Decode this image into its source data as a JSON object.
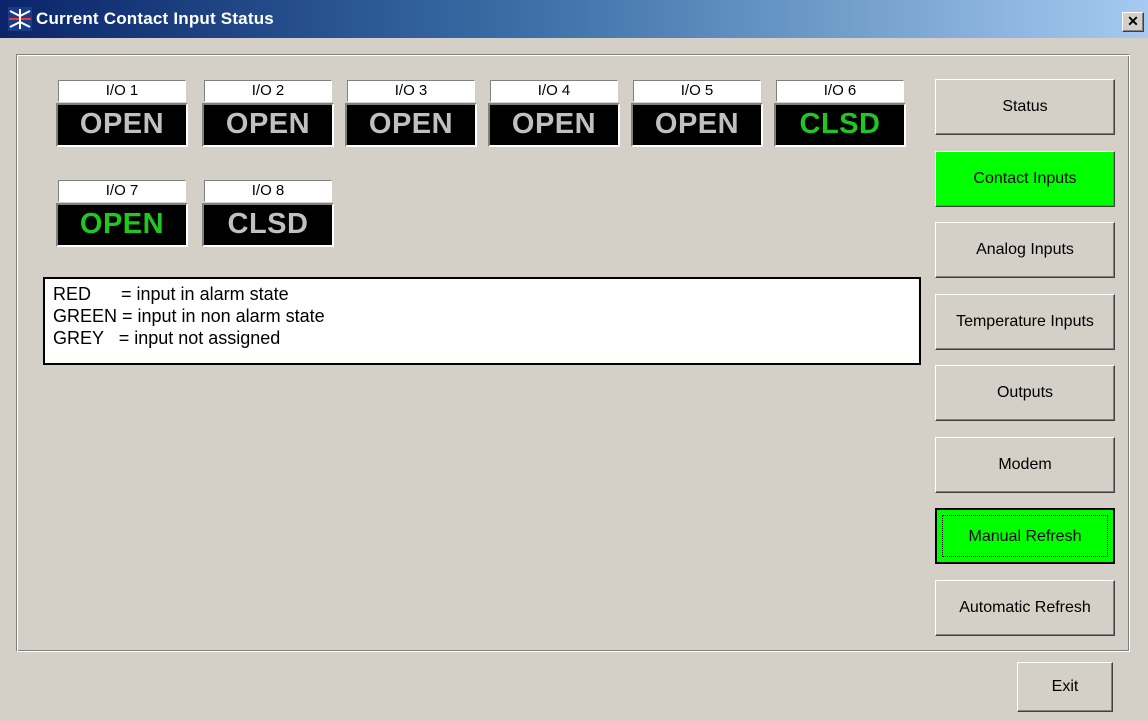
{
  "window": {
    "title": "Current Contact Input Status",
    "close_label": "✕"
  },
  "colors": {
    "open_grey": "#c0c0c0",
    "active_green": "#00ff00",
    "io_green": "#1ec81e"
  },
  "inputs": [
    {
      "label": "I/O 1",
      "state": "OPEN",
      "color": "#c0c0c0"
    },
    {
      "label": "I/O 2",
      "state": "OPEN",
      "color": "#c0c0c0"
    },
    {
      "label": "I/O 3",
      "state": "OPEN",
      "color": "#c0c0c0"
    },
    {
      "label": "I/O 4",
      "state": "OPEN",
      "color": "#c0c0c0"
    },
    {
      "label": "I/O 5",
      "state": "OPEN",
      "color": "#c0c0c0"
    },
    {
      "label": "I/O 6",
      "state": "CLSD",
      "color": "#1ec81e"
    },
    {
      "label": "I/O 7",
      "state": "OPEN",
      "color": "#1ec81e"
    },
    {
      "label": "I/O 8",
      "state": "CLSD",
      "color": "#c0c0c0"
    }
  ],
  "legend": {
    "lines": [
      "RED      = input in alarm state",
      "GREEN = input in non alarm state",
      "GREY   = input not assigned"
    ]
  },
  "nav": {
    "buttons": [
      {
        "label": "Status",
        "active": false
      },
      {
        "label": "Contact Inputs",
        "active": true
      },
      {
        "label": "Analog Inputs",
        "active": false
      },
      {
        "label": "Temperature Inputs",
        "active": false
      },
      {
        "label": "Outputs",
        "active": false
      },
      {
        "label": "Modem",
        "active": false
      },
      {
        "label": "Manual Refresh",
        "active": true
      },
      {
        "label": "Automatic Refresh",
        "active": false
      }
    ]
  },
  "footer": {
    "exit_label": "Exit"
  }
}
